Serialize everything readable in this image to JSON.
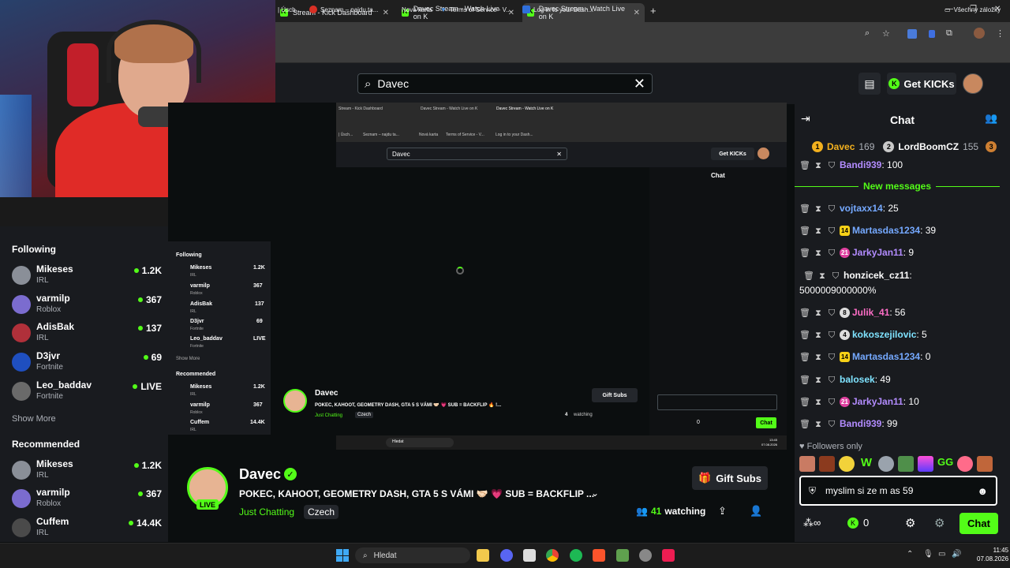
{
  "browser": {
    "tabs": [
      {
        "title": "Stream - Kick Dashboard"
      },
      {
        "title": "Davec Stream - Watch Live on K"
      },
      {
        "title": "Davec Stream - Watch Live on K"
      }
    ],
    "new_tab": "+",
    "bookmarks": [
      {
        "label": "| Úsch..."
      },
      {
        "label": "Seznam – najdu ta..."
      },
      {
        "label": "Nová karta"
      },
      {
        "label": "Terms of Service - V..."
      },
      {
        "label": "Log in to your Dash..."
      }
    ],
    "all_bookmarks": "Všechny záložky"
  },
  "header": {
    "search_value": "Davec",
    "get_kicks": "Get KICKs"
  },
  "sidebar": {
    "following_title": "Following",
    "following": [
      {
        "name": "Mikeses",
        "category": "IRL",
        "count": "1.2K",
        "color": "#8a8f98"
      },
      {
        "name": "varmilp",
        "category": "Roblox",
        "count": "367",
        "color": "#7b6ccf"
      },
      {
        "name": "AdisBak",
        "category": "IRL",
        "count": "137",
        "color": "#b0303a"
      },
      {
        "name": "D3jvr",
        "category": "Fortnite",
        "count": "69",
        "color": "#1f4fbf"
      },
      {
        "name": "Leo_baddav",
        "category": "Fortnite",
        "count": "LIVE",
        "color": "#6a6a6a"
      }
    ],
    "show_more": "Show More",
    "recommended_title": "Recommended",
    "recommended": [
      {
        "name": "Mikeses",
        "category": "IRL",
        "count": "1.2K",
        "color": "#8a8f98"
      },
      {
        "name": "varmilp",
        "category": "Roblox",
        "count": "367",
        "color": "#7b6ccf"
      },
      {
        "name": "Cuffem",
        "category": "IRL",
        "count": "14.4K",
        "color": "#4a4a4a"
      }
    ]
  },
  "stream": {
    "name": "Davec",
    "live": "LIVE",
    "title": "POKEC, KAHOOT, GEOMETRY DASH, GTA 5 S VÁMI 🤝🏻 💗 SUB = BACKFLIP ...",
    "category": "Just Chatting",
    "language": "Czech",
    "gift_subs": "Gift Subs",
    "viewers": "41",
    "watching": "watching"
  },
  "nested": {
    "search_value": "Davec",
    "get_kicks": "Get KICKs",
    "chat_title": "Chat",
    "following_title": "Following",
    "following": [
      {
        "name": "Mikeses",
        "category": "IRL",
        "count": "1.2K"
      },
      {
        "name": "varmilp",
        "category": "Roblox",
        "count": "367"
      },
      {
        "name": "AdisBak",
        "category": "IRL",
        "count": "137"
      },
      {
        "name": "D3jvr",
        "category": "Fortnite",
        "count": "69"
      },
      {
        "name": "Leo_baddav",
        "category": "Fortnite",
        "count": "LIVE"
      }
    ],
    "show_more": "Show More",
    "recommended_title": "Recommended",
    "recommended": [
      {
        "name": "Mikeses",
        "category": "IRL",
        "count": "1.2K"
      },
      {
        "name": "varmilp",
        "category": "Roblox",
        "count": "367"
      },
      {
        "name": "Cuffem",
        "category": "IRL",
        "count": "14.4K"
      }
    ],
    "stream_name": "Davec",
    "stream_title": "POKEC, KAHOOT, GEOMETRY DASH, GTA 5 S VÁMI 🤝🏻 💗 SUB = BACKFLIP 🔥 !...",
    "category": "Just Chatting",
    "language": "Czech",
    "gift_subs": "Gift Subs",
    "viewers": "4",
    "watching": "watching",
    "kicks": "0",
    "chat_btn": "Chat",
    "tb_search": "Hledat",
    "clock_time": "13:45",
    "clock_date": "07.08.2026"
  },
  "chat": {
    "title": "Chat",
    "leaderboard": [
      {
        "rank": "1",
        "name": "Davec",
        "score": "169",
        "color": "#f2b01e"
      },
      {
        "rank": "2",
        "name": "LordBoomCZ",
        "score": "155",
        "color": "#c9c9c9"
      },
      {
        "rank": "3",
        "name": "",
        "score": "",
        "color": "#cd7f32"
      }
    ],
    "new_messages": "New messages",
    "messages_before": [
      {
        "user": "Bandi939",
        "text": ": 100",
        "color": "#b38cff",
        "badge": ""
      }
    ],
    "messages": [
      {
        "user": "vojtaxx14",
        "text": ": 25",
        "color": "#75a9ff",
        "badge": "",
        "badge_color": ""
      },
      {
        "user": "Martasdas1234",
        "text": ": 39",
        "color": "#75a9ff",
        "badge": "14",
        "badge_color": "#f7d117"
      },
      {
        "user": "JarkyJan11",
        "text": ": 9",
        "color": "#b38cff",
        "badge": "21",
        "badge_color": "#e040a0"
      },
      {
        "user": "honzicek_cz11",
        "text": ":",
        "color": "#ffffff",
        "badge": "",
        "badge_color": ""
      },
      {
        "user": "Julik_41",
        "text": ": 56",
        "color": "#ff6ec7",
        "badge": "8",
        "badge_color": "#dddddd"
      },
      {
        "user": "kokoszejilovic",
        "text": ": 5",
        "color": "#7fe3ff",
        "badge": "4",
        "badge_color": "#dddddd"
      },
      {
        "user": "Martasdas1234",
        "text": ": 0",
        "color": "#75a9ff",
        "badge": "14",
        "badge_color": "#f7d117"
      },
      {
        "user": "balosek",
        "text": ": 49",
        "color": "#7fe3ff",
        "badge": "",
        "badge_color": ""
      },
      {
        "user": "JarkyJan11",
        "text": ": 10",
        "color": "#b38cff",
        "badge": "21",
        "badge_color": "#e040a0"
      },
      {
        "user": "Bandi939",
        "text": ": 99",
        "color": "#b38cff",
        "badge": "",
        "badge_color": ""
      }
    ],
    "honzicek_continuation": "5000009000000%",
    "followers_only": "Followers only",
    "input_value": "myslim si ze m as 59",
    "kicks": "0",
    "send": "Chat"
  },
  "taskbar": {
    "search": "Hledat",
    "time": "11:45",
    "date": "07.08.2026"
  },
  "colors": {
    "accent": "#53fc18",
    "background": "#0b0e0f",
    "panel": "#191b1f"
  }
}
